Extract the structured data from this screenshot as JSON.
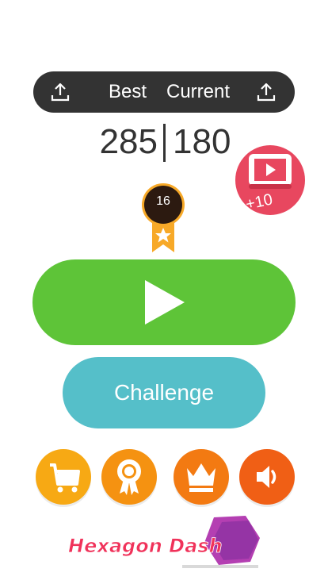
{
  "header": {
    "best_label": "Best",
    "current_label": "Current",
    "left_icon": "share-icon",
    "right_icon": "share-icon"
  },
  "scores": {
    "best": "285",
    "current": "180"
  },
  "video_reward": {
    "icon": "video-play-icon",
    "label": "+10",
    "color": "#e8475f"
  },
  "level": {
    "value": "16",
    "icon": "star-ribbon-icon",
    "ribbon_color": "#f7a928",
    "medal_color": "#2c1a10"
  },
  "buttons": {
    "play_icon": "play-icon",
    "play_color": "#5ec438",
    "challenge_label": "Challenge",
    "challenge_color": "#55bfc9",
    "bottom": [
      {
        "name": "shop",
        "icon": "cart-icon",
        "color": "#f7a914"
      },
      {
        "name": "achievements",
        "icon": "award-icon",
        "color": "#f59211"
      },
      {
        "name": "leaderboard",
        "icon": "crown-icon",
        "color": "#f37a12"
      },
      {
        "name": "sound",
        "icon": "speaker-icon",
        "color": "#f05f15"
      }
    ]
  },
  "logo": {
    "text": "Hexagon Dash"
  }
}
